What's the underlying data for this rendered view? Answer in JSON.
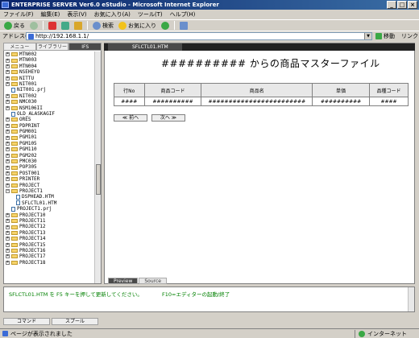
{
  "window": {
    "title": "ENTERPRISE SERVER Ver6.0 eStudio - Microsoft Internet Explorer"
  },
  "menu": [
    "ファイル(F)",
    "編集(E)",
    "表示(V)",
    "お気に入り(A)",
    "ツール(T)",
    "ヘルプ(H)"
  ],
  "toolbar": {
    "back": "戻る",
    "search": "検索",
    "favorites": "お気に入り"
  },
  "address": {
    "label": "アドレス(D)",
    "url": "http://192.168.1.1/",
    "go": "移動",
    "links": "リンク"
  },
  "left_tabs": [
    "メニュー",
    "ライブラリー",
    "IFS"
  ],
  "tree": [
    {
      "t": "f",
      "label": "MTN002"
    },
    {
      "t": "f",
      "label": "MTN003"
    },
    {
      "t": "f",
      "label": "MTN004"
    },
    {
      "t": "f",
      "label": "NSEHEYO"
    },
    {
      "t": "f",
      "label": "NITTU"
    },
    {
      "t": "f",
      "label": "NIT001"
    },
    {
      "t": "p",
      "label": "NIT001.prj"
    },
    {
      "t": "f",
      "label": "NIT002"
    },
    {
      "t": "f",
      "label": "NMC030"
    },
    {
      "t": "f",
      "label": "NSM106II"
    },
    {
      "t": "p",
      "label": "OLD_ALASKAGIF"
    },
    {
      "t": "f",
      "label": "ORES"
    },
    {
      "t": "f",
      "label": "PDPRINT"
    },
    {
      "t": "f",
      "label": "PGM001"
    },
    {
      "t": "f",
      "label": "PGM101"
    },
    {
      "t": "f",
      "label": "PGM105"
    },
    {
      "t": "f",
      "label": "PGM110"
    },
    {
      "t": "f",
      "label": "PGM202"
    },
    {
      "t": "f",
      "label": "PMC030"
    },
    {
      "t": "f",
      "label": "POP305"
    },
    {
      "t": "f",
      "label": "POST001"
    },
    {
      "t": "f",
      "label": "PRINTER"
    },
    {
      "t": "f",
      "label": "PROJECT"
    },
    {
      "t": "o",
      "label": "PROJECT1"
    },
    {
      "t": "c",
      "label": "DSPHEAD.HTM"
    },
    {
      "t": "c",
      "label": "SFLCTL01.HTM"
    },
    {
      "t": "p",
      "label": "PROJECT1.prj"
    },
    {
      "t": "f",
      "label": "PROJECT10"
    },
    {
      "t": "f",
      "label": "PROJECT11"
    },
    {
      "t": "f",
      "label": "PROJECT12"
    },
    {
      "t": "f",
      "label": "PROJECT13"
    },
    {
      "t": "f",
      "label": "PROJECT14"
    },
    {
      "t": "f",
      "label": "PROJECT15"
    },
    {
      "t": "f",
      "label": "PROJECT16"
    },
    {
      "t": "f",
      "label": "PROJECT17"
    },
    {
      "t": "f",
      "label": "PROJECT18"
    }
  ],
  "right_tab": "SFLCTL01.HTM",
  "page": {
    "title": "##########  からの商品マスターファイル",
    "columns": [
      "行No",
      "商品コード",
      "商品名",
      "単価",
      "品種コード"
    ],
    "row": [
      "####",
      "##########",
      "########################",
      "##########",
      "####"
    ],
    "prev": "≪ 前へ",
    "next": "次へ ≫"
  },
  "bottom_tabs": [
    "Preview",
    "Source"
  ],
  "console": {
    "message": "SFLCTL01.HTM を F5 キーを押して更新してください。",
    "hint": "F10=エディターの起動/終了"
  },
  "console_tabs": [
    "コマンド",
    "スプール"
  ],
  "status": {
    "text": "ページが表示されました",
    "zone": "インターネット"
  }
}
